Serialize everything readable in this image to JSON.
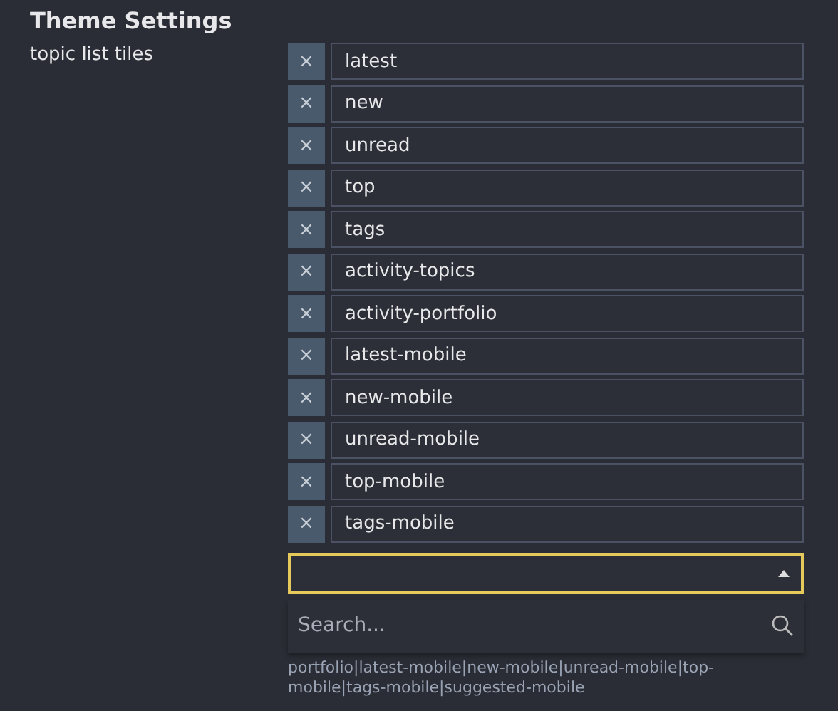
{
  "heading": "Theme Settings",
  "setting": {
    "label": "topic list tiles",
    "values": [
      {
        "remove": "×",
        "value": "latest"
      },
      {
        "remove": "×",
        "value": "new"
      },
      {
        "remove": "×",
        "value": "unread"
      },
      {
        "remove": "×",
        "value": "top"
      },
      {
        "remove": "×",
        "value": "tags"
      },
      {
        "remove": "×",
        "value": "activity-topics"
      },
      {
        "remove": "×",
        "value": "activity-portfolio"
      },
      {
        "remove": "×",
        "value": "latest-mobile"
      },
      {
        "remove": "×",
        "value": "new-mobile"
      },
      {
        "remove": "×",
        "value": "unread-mobile"
      },
      {
        "remove": "×",
        "value": "top-mobile"
      },
      {
        "remove": "×",
        "value": "tags-mobile"
      }
    ],
    "dropdown": {
      "expanded": true,
      "search_placeholder": "Search..."
    },
    "description": "portfolio|latest-mobile|new-mobile|unread-mobile|top-mobile|tags-mobile|suggested-mobile"
  }
}
